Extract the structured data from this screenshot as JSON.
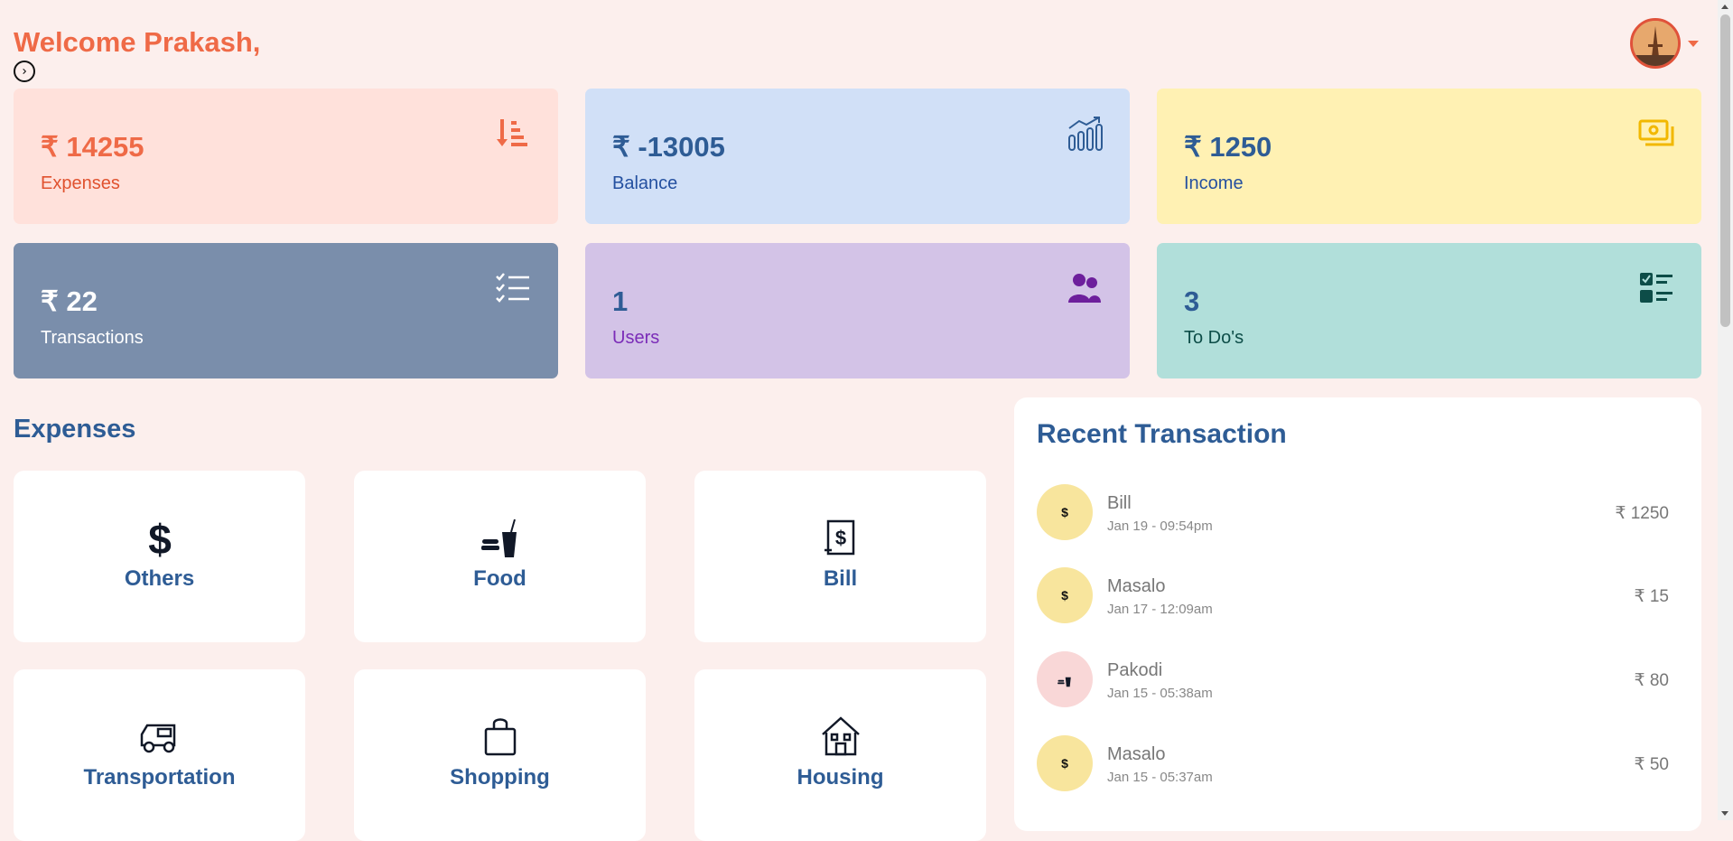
{
  "header": {
    "welcome": "Welcome Prakash,",
    "avatar_icon": "user-avatar",
    "toggle_icon": "chevron-right-circle-icon"
  },
  "stats": [
    {
      "value": "₹ 14255",
      "label": "Expenses",
      "icon": "sort-descending-icon",
      "bg": "#ffe1db",
      "value_color": "#ef6a47",
      "label_color": "#e0522f"
    },
    {
      "value": "₹ -13005",
      "label": "Balance",
      "icon": "bar-chart-growth-icon",
      "bg": "#d1e0f7",
      "value_color": "#2e5c95",
      "label_color": "#2450a0"
    },
    {
      "value": "₹ 1250",
      "label": "Income",
      "icon": "money-icon",
      "bg": "#fff1b3",
      "value_color": "#2e5c95",
      "label_color": "#2450a0"
    },
    {
      "value": "₹ 22",
      "label": "Transactions",
      "icon": "checklist-icon",
      "bg": "#7a8eab",
      "value_color": "#ffffff",
      "label_color": "#ffffff"
    },
    {
      "value": "1",
      "label": "Users",
      "icon": "users-icon",
      "bg": "#d3c3e7",
      "value_color": "#2e5c95",
      "label_color": "#7b2cb8"
    },
    {
      "value": "3",
      "label": "To Do's",
      "icon": "todo-list-icon",
      "bg": "#b1dfda",
      "value_color": "#2e5c95",
      "label_color": "#0d4d48"
    }
  ],
  "expenses": {
    "title": "Expenses",
    "categories": [
      {
        "name": "Others",
        "icon": "dollar-icon"
      },
      {
        "name": "Food",
        "icon": "food-drink-icon"
      },
      {
        "name": "Bill",
        "icon": "bill-receipt-icon"
      },
      {
        "name": "Transportation",
        "icon": "truck-icon"
      },
      {
        "name": "Shopping",
        "icon": "shopping-bag-icon"
      },
      {
        "name": "Housing",
        "icon": "house-icon"
      }
    ]
  },
  "recent": {
    "title": "Recent Transaction",
    "items": [
      {
        "name": "Bill",
        "date": "Jan 19 - 09:54pm",
        "amount": "₹ 1250",
        "icon": "dollar-icon",
        "bg": "#f8e59d"
      },
      {
        "name": "Masalo",
        "date": "Jan 17 - 12:09am",
        "amount": "₹ 15",
        "icon": "dollar-icon",
        "bg": "#f8e59d"
      },
      {
        "name": "Pakodi",
        "date": "Jan 15 - 05:38am",
        "amount": "₹ 80",
        "icon": "food-drink-icon",
        "bg": "#f9d7d7"
      },
      {
        "name": "Masalo",
        "date": "Jan 15 - 05:37am",
        "amount": "₹ 50",
        "icon": "dollar-icon",
        "bg": "#f8e59d"
      }
    ]
  }
}
